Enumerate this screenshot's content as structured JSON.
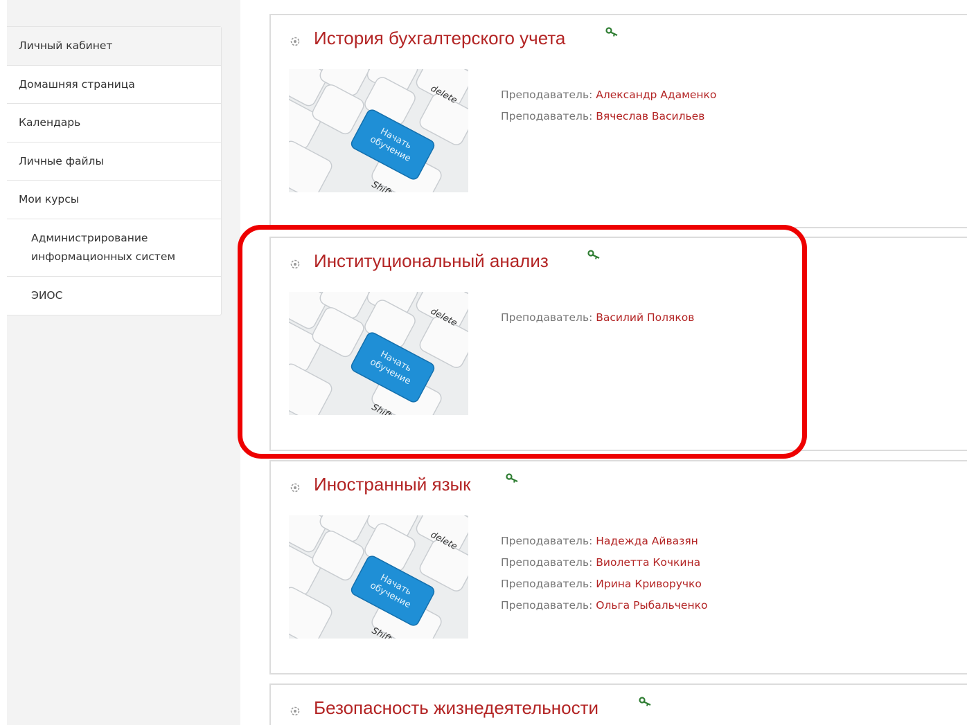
{
  "nav": {
    "items": [
      {
        "label": "Личный кабинет"
      },
      {
        "label": "Домашняя страница"
      },
      {
        "label": "Календарь"
      },
      {
        "label": "Личные файлы"
      },
      {
        "label": "Мои курсы"
      },
      {
        "label": "Администрирование информационных систем"
      },
      {
        "label": "ЭИОС"
      }
    ]
  },
  "courses": [
    {
      "title": "История бухгалтерского учета",
      "image_text": [
        "delete",
        "Начать",
        "обучение",
        "Shift"
      ],
      "teachers": [
        {
          "role": "Преподаватель:",
          "name": "Александр Адаменко"
        },
        {
          "role": "Преподаватель:",
          "name": "Вячеслав Васильев"
        }
      ]
    },
    {
      "title": "Институциональный анализ",
      "image_text": [
        "delete",
        "Начать",
        "обучение",
        "Shift"
      ],
      "teachers": [
        {
          "role": "Преподаватель:",
          "name": "Василий Поляков"
        }
      ]
    },
    {
      "title": "Иностранный язык",
      "image_text": [
        "delete",
        "Начать",
        "обучение",
        "Shift"
      ],
      "teachers": [
        {
          "role": "Преподаватель:",
          "name": "Надежда Айвазян"
        },
        {
          "role": "Преподаватель:",
          "name": "Виолетта Кочкина"
        },
        {
          "role": "Преподаватель:",
          "name": "Ирина Криворучко"
        },
        {
          "role": "Преподаватель:",
          "name": "Ольга Рыбальченко"
        }
      ]
    },
    {
      "title": "Безопасность жизнедеятельности"
    }
  ],
  "colors": {
    "accent": "#b32424",
    "key_icon": "#2e7d32",
    "highlight": "#ee0000",
    "image_button": "#1f8fd6"
  },
  "icons": {
    "course": "course-icon",
    "guest_access": "key-icon"
  }
}
